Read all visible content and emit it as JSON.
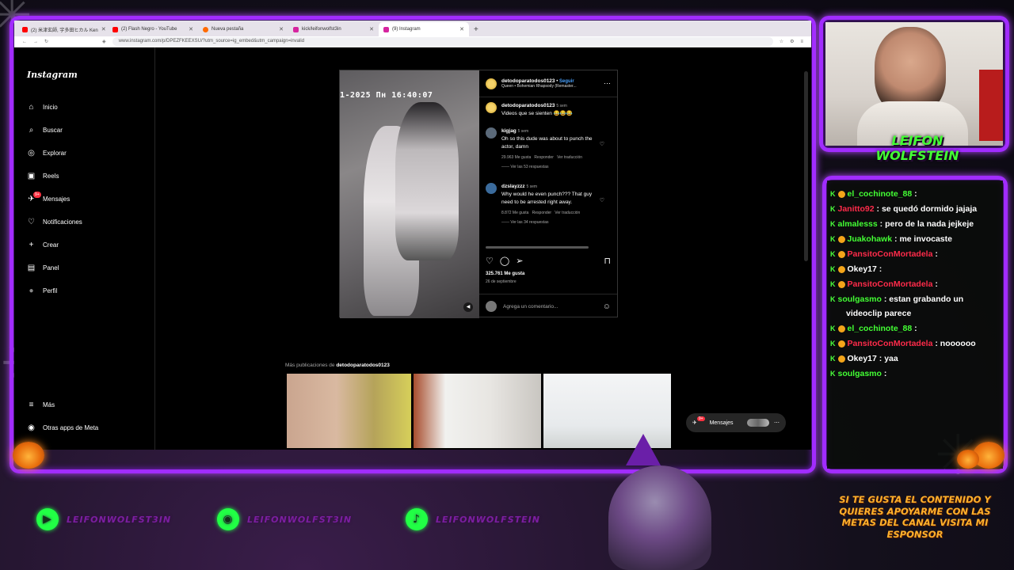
{
  "browser": {
    "tabs": [
      {
        "title": "(2) 米津玄師, 宇多田ヒカル Ken",
        "color": "#ff0000"
      },
      {
        "title": "(2) Flash Negro - YouTube",
        "color": "#ff0000"
      },
      {
        "title": "Nueva pestaña",
        "color": "#ff6a00"
      },
      {
        "title": "kick/leifonwolfst3in",
        "color": "#53fc18"
      },
      {
        "title": "(9) Instagram",
        "color": "#d6249f"
      }
    ],
    "url": "www.instagram.com/p/DPEZFKEEXSU/?utm_source=ig_embed&utm_campaign=invalid"
  },
  "instagram": {
    "logo": "Instagram",
    "nav": [
      {
        "label": "Inicio",
        "icon": "home-icon",
        "glyph": "⌂"
      },
      {
        "label": "Buscar",
        "icon": "search-icon",
        "glyph": "⌕"
      },
      {
        "label": "Explorar",
        "icon": "compass-icon",
        "glyph": "◎"
      },
      {
        "label": "Reels",
        "icon": "reels-icon",
        "glyph": "▣"
      },
      {
        "label": "Mensajes",
        "icon": "messenger-icon",
        "glyph": "✈"
      },
      {
        "label": "Notificaciones",
        "icon": "heart-icon",
        "glyph": "♡"
      },
      {
        "label": "Crear",
        "icon": "plus-icon",
        "glyph": "+"
      },
      {
        "label": "Panel",
        "icon": "dashboard-icon",
        "glyph": "▤"
      },
      {
        "label": "Perfil",
        "icon": "avatar-icon",
        "glyph": "●"
      }
    ],
    "nav_bottom": [
      {
        "label": "Más",
        "icon": "menu-icon",
        "glyph": "≡"
      },
      {
        "label": "Otras apps de Meta",
        "icon": "meta-icon",
        "glyph": "◉"
      }
    ],
    "messages_badge": "9+",
    "post": {
      "video_timestamp": "1-2025 Пн 16:40:07",
      "username": "detodoparatodos0123",
      "follow": "Seguir",
      "audio": "Queen • Bohemian Rhapsody (Remaster...",
      "caption": {
        "user": "detodoparatodos0123",
        "time": "5 sem",
        "text": "Videos que se sienten 😂😂😂"
      },
      "comments": [
        {
          "user": "kigjag",
          "time": "5 sem",
          "text": "Oh so this dude was about to punch the actor, damn",
          "likes": "29.963 Me gusta",
          "reply": "Responder",
          "translate": "Ver traducción",
          "replies": "Ver las 53 respuestas"
        },
        {
          "user": "dzslayzzz",
          "time": "5 sem",
          "text": "Why would he even punch??? That guy need to be arrested right away.",
          "likes": "8.872 Me gusta",
          "reply": "Responder",
          "translate": "Ver traducción",
          "replies": "Ver las 34 respuestas"
        }
      ],
      "like_count": "325.761 Me gusta",
      "date": "26 de septiembre",
      "comment_placeholder": "Agrega un comentario..."
    },
    "more_prefix": "Más publicaciones de",
    "more_user": "detodoparatodos0123",
    "messages_pill": "Mensajes",
    "messages_pill_badge": "9+"
  },
  "chat": [
    {
      "user": "el_cochinote_88",
      "color": "#43ff34",
      "text": ""
    },
    {
      "user": "Janitto92",
      "color": "#ff2b4a",
      "text": "se quedó dormido jajaja"
    },
    {
      "user": "almalesss",
      "color": "#43ff34",
      "text": "pero de la nada jejkeje"
    },
    {
      "user": "Juakohawk",
      "color": "#43ff34",
      "text": "me invocaste"
    },
    {
      "user": "PansitoConMortadela",
      "color": "#ff2b4a",
      "text": ""
    },
    {
      "user": "Okey17",
      "color": "#ffffff",
      "text": ""
    },
    {
      "user": "PansitoConMortadela",
      "color": "#ff2b4a",
      "text": ""
    },
    {
      "user": "soulgasmo",
      "color": "#43ff34",
      "text": "estan grabando un videoclip parece"
    },
    {
      "user": "el_cochinote_88",
      "color": "#43ff34",
      "text": ""
    },
    {
      "user": "PansitoConMortadela",
      "color": "#ff2b4a",
      "text": "noooooo"
    },
    {
      "user": "Okey17",
      "color": "#ffffff",
      "text": "yaa"
    },
    {
      "user": "soulgasmo",
      "color": "#43ff34",
      "text": ""
    }
  ],
  "overlay": {
    "brand": "LEIFON WOLFSTEIN",
    "socials": [
      {
        "handle": "LEIFONWOLFST3IN",
        "icon": "kick-icon",
        "glyph": "▶"
      },
      {
        "handle": "LEIFONWOLFST3IN",
        "icon": "twitch-icon",
        "glyph": "◉"
      },
      {
        "handle": "LEIFONWOLFSTEIN",
        "icon": "tiktok-icon",
        "glyph": "♪"
      }
    ],
    "sponsor_text": "SI TE GUSTA EL CONTENIDO Y QUIERES APOYARME CON LAS METAS DEL CANAL VISITA MI ESPONSOR"
  },
  "colors": {
    "accent": "#a12cff",
    "chat_green": "#43ff34",
    "sponsor": "#ffb12c"
  }
}
